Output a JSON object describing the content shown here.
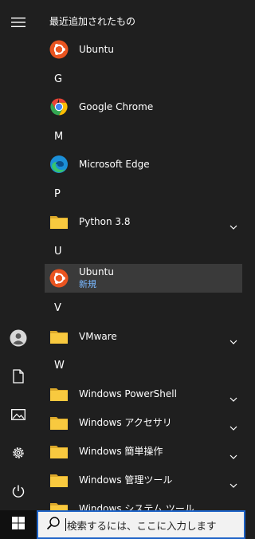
{
  "start_menu": {
    "recent_header": "最近追加されたもの",
    "sections": [
      {
        "letter": "",
        "items": [
          {
            "label": "Ubuntu",
            "icon": "ubuntu-icon"
          }
        ]
      },
      {
        "letter": "G",
        "items": [
          {
            "label": "Google Chrome",
            "icon": "chrome-icon"
          }
        ]
      },
      {
        "letter": "M",
        "items": [
          {
            "label": "Microsoft Edge",
            "icon": "edge-icon"
          }
        ]
      },
      {
        "letter": "P",
        "items": [
          {
            "label": "Python 3.8",
            "icon": "folder-icon",
            "expandable": true
          }
        ]
      },
      {
        "letter": "U",
        "items": [
          {
            "label": "Ubuntu",
            "sublabel": "新規",
            "icon": "ubuntu-icon",
            "selected": true
          }
        ]
      },
      {
        "letter": "V",
        "items": [
          {
            "label": "VMware",
            "icon": "folder-icon",
            "expandable": true
          }
        ]
      },
      {
        "letter": "W",
        "items": [
          {
            "label": "Windows PowerShell",
            "icon": "folder-icon",
            "expandable": true
          },
          {
            "label": "Windows アクセサリ",
            "icon": "folder-icon",
            "expandable": true
          },
          {
            "label": "Windows 簡単操作",
            "icon": "folder-icon",
            "expandable": true
          },
          {
            "label": "Windows 管理ツール",
            "icon": "folder-icon",
            "expandable": true
          },
          {
            "label": "Windows システム ツール",
            "icon": "folder-icon",
            "expandable": true
          }
        ]
      }
    ]
  },
  "rail": [
    "hamburger-menu-icon",
    "user-account-icon",
    "documents-icon",
    "pictures-icon",
    "settings-icon",
    "power-icon"
  ],
  "taskbar": {
    "search_placeholder": "検索するには、ここに入力します"
  },
  "colors": {
    "background": "#1f1f1f",
    "selected": "#3a3a3a",
    "accent_text": "#79b8ff",
    "ubuntu": "#e95420",
    "folder": "#f8c93f",
    "search_border": "#1e63c7"
  }
}
